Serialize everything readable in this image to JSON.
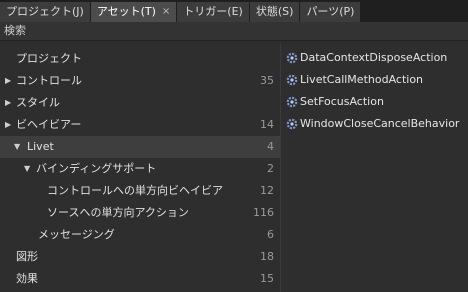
{
  "tabs": [
    {
      "label": "プロジェクト(J)"
    },
    {
      "label": "アセット(T)",
      "close": "×"
    },
    {
      "label": "トリガー(E)"
    },
    {
      "label": "状態(S)"
    },
    {
      "label": "パーツ(P)"
    }
  ],
  "search": {
    "label": "検索"
  },
  "tree": [
    {
      "label": "プロジェクト",
      "count": ""
    },
    {
      "label": "コントロール",
      "count": "35"
    },
    {
      "label": "スタイル",
      "count": ""
    },
    {
      "label": "ビヘイビアー",
      "count": "14"
    },
    {
      "label": "Livet",
      "count": "4"
    },
    {
      "label": "バインディングサポート",
      "count": "2"
    },
    {
      "label": "コントロールへの単方向ビヘイビア",
      "count": "12"
    },
    {
      "label": "ソースへの単方向アクション",
      "count": "116"
    },
    {
      "label": "メッセージング",
      "count": "6"
    },
    {
      "label": "図形",
      "count": "18"
    },
    {
      "label": "効果",
      "count": "15"
    }
  ],
  "actions": [
    {
      "label": "DataContextDisposeAction",
      "icon": "gear-icon"
    },
    {
      "label": "LivetCallMethodAction",
      "icon": "gear-icon"
    },
    {
      "label": "SetFocusAction",
      "icon": "gear-icon"
    },
    {
      "label": "WindowCloseCancelBehavior",
      "icon": "gear-icon"
    }
  ],
  "colors": {
    "background": "#2e2e2e",
    "tabbar": "#1f1f1f",
    "selected_row": "#3e3e3e",
    "icon_blue": "#6f8fd0"
  }
}
